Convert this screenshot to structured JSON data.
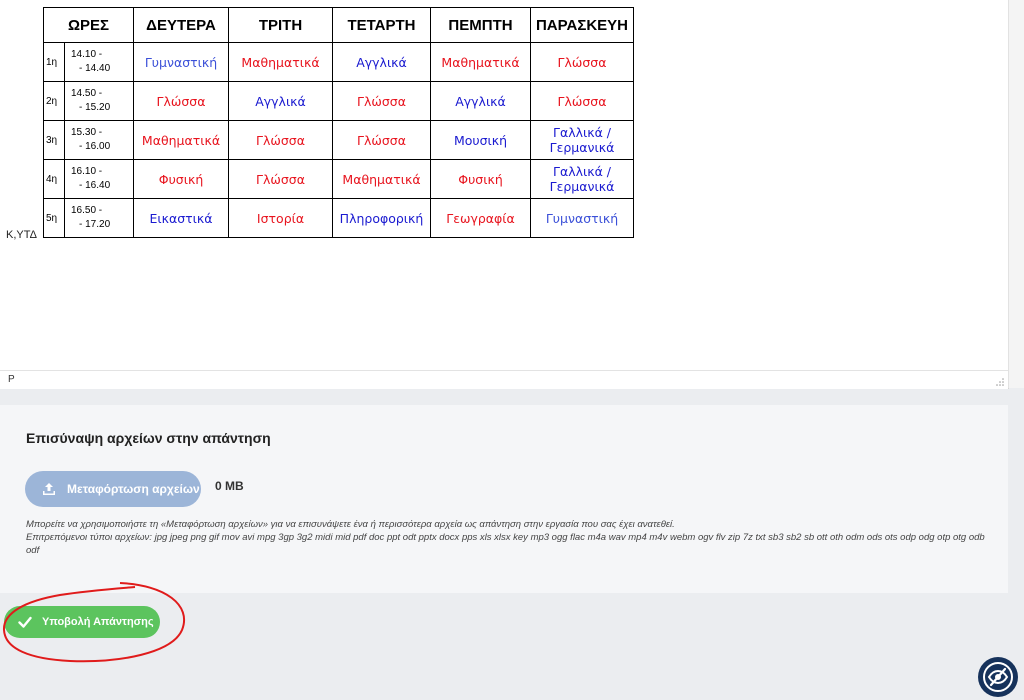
{
  "timetable": {
    "headers": [
      "ΩΡΕΣ",
      "ΔΕΥΤΕΡΑ",
      "ΤΡΙΤΗ",
      "ΤΕΤΑΡΤΗ",
      "ΠΕΜΠΤΗ",
      "ΠΑΡΑΣΚΕΥΗ"
    ],
    "rows": [
      {
        "num": "1η",
        "start": "14.10 -",
        "end": "- 14.40",
        "cells": [
          "Γυμναστική",
          "Μαθηματικά",
          "Αγγλικά",
          "Μαθηματικά",
          "Γλώσσα"
        ]
      },
      {
        "num": "2η",
        "start": "14.50 -",
        "end": "- 15.20",
        "cells": [
          "Γλώσσα",
          "Αγγλικά",
          "Γλώσσα",
          "Αγγλικά",
          "Γλώσσα"
        ]
      },
      {
        "num": "3η",
        "start": "15.30 -",
        "end": "- 16.00",
        "cells": [
          "Μαθηματικά",
          "Γλώσσα",
          "Γλώσσα",
          "Μουσική",
          "Γαλλικά / Γερμανικά"
        ]
      },
      {
        "num": "4η",
        "start": "16.10 -",
        "end": "- 16.40",
        "cells": [
          "Φυσική",
          "Γλώσσα",
          "Μαθηματικά",
          "Φυσική",
          "Γαλλικά / Γερμανικά"
        ]
      },
      {
        "num": "5η",
        "start": "16.50 -",
        "end": "- 17.20",
        "cells": [
          "Εικαστικά",
          "Ιστορία",
          "Πληροφορική",
          "Γεωγραφία",
          "Γυμναστική"
        ]
      }
    ],
    "colors": {
      "red": "#e8141e",
      "blue": "#1a1ad0",
      "lightblue": "#3b50d8"
    }
  },
  "editor": {
    "left_label": "Κ,ΥΤΔ",
    "status_path": "P"
  },
  "attachments": {
    "title": "Επισύναψη αρχείων στην απάντηση",
    "upload_label": "Μεταφόρτωση αρχείων",
    "upload_icon": "upload-icon",
    "size": "0 MB",
    "help_line1": "Μπορείτε να χρησιμοποιήστε τη «Μεταφόρτωση αρχείων» για να επισυνάψετε ένα ή περισσότερα αρχεία ως απάντηση στην εργασία που σας έχει ανατεθεί.",
    "help_line2": "Επιτρεπόμενοι τύποι αρχείων: jpg jpeg png gif mov avi mpg 3gp 3g2 midi mid pdf doc ppt odt pptx docx pps xls xlsx key mp3 ogg flac m4a wav mp4 m4v webm ogv flv zip 7z txt sb3 sb2 sb ott oth odm ods ots odp odg otp otg odb odf"
  },
  "submit": {
    "label": "Υποβολή Απάντησης",
    "icon": "checkmark-icon"
  },
  "accessibility": {
    "icon": "eye-slash-icon"
  }
}
